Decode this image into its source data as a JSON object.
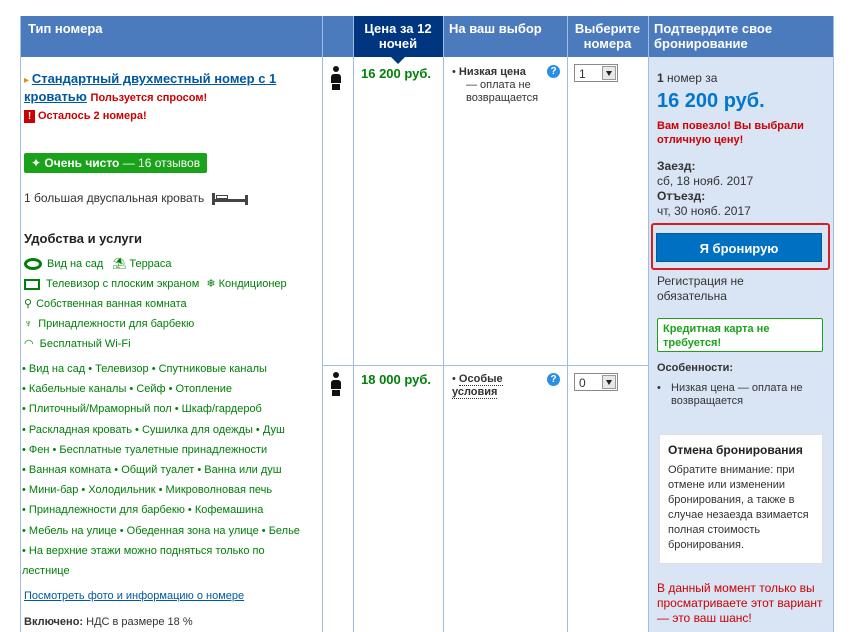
{
  "header": {
    "room_type": "Тип номера",
    "price_for_12": "Цена за 12 ночей",
    "your_choice": "На ваш выбор",
    "select_rooms": "Выберите номера",
    "confirm": "Подтвердите свое бронирование"
  },
  "room": {
    "name": "Стандартный двухместный номер с 1 кроватью",
    "demand": "Пользуется спросом!",
    "left": "Осталось 2 номера!",
    "clean_badge": "Очень чисто",
    "clean_reviews": " — 16 отзывов",
    "bed": "1 большая двуспальная кровать",
    "amenities_title": "Удобства и услуги",
    "view_link": "Посмотреть фото и информацию о номере",
    "included_label": "Включено:",
    "included_value": " НДС в размере 18 %"
  },
  "amenities_icons": {
    "garden": "Вид на сад",
    "terrace": "Терраса",
    "tv": "Телевизор с плоским экраном",
    "ac": "Кондиционер",
    "bath": "Собственная ванная комната",
    "bbq": "Принадлежности для барбекю",
    "wifi": "Бесплатный Wi-Fi"
  },
  "facility_lines": [
    "• Вид на сад  • Телевизор  • Спутниковые каналы",
    "• Кабельные каналы  • Сейф  • Отопление",
    "• Плиточный/Мраморный пол  • Шкаф/гардероб",
    "• Раскладная кровать  • Сушилка для одежды  • Душ",
    "• Фен  • Бесплатные туалетные принадлежности",
    "• Ванная комната  • Общий туалет  • Ванна или душ",
    "• Мини-бар  • Холодильник  • Микроволновая печь",
    "• Принадлежности для барбекю  • Кофемашина",
    "• Мебель на улице  • Обеденная зона на улице  • Белье",
    "• На верхние этажи можно подняться только по",
    "лестнице"
  ],
  "offers": [
    {
      "price": "16 200 руб.",
      "cond_title": "Низкая цена",
      "cond_text": "— оплата не возвращается",
      "qty": "1"
    },
    {
      "price": "18 000 руб.",
      "cond_title": "Особые условия",
      "qty": "0"
    }
  ],
  "confirm": {
    "rooms_count": "1",
    "rooms_label": " номер за",
    "total": "16 200 руб.",
    "lucky": "Вам повезло! Вы выбрали отличную цену!",
    "checkin_label": "Заезд:",
    "checkin_date": "сб, 18 нояб. 2017",
    "checkout_label": "Отъезд:",
    "checkout_date": "чт, 30 нояб. 2017",
    "book_button": "Я бронирую",
    "registration": "Регистрация не обязательна",
    "no_card": "Кредитная карта не требуется!",
    "features_title": "Особенности:",
    "feature_1": "Низкая цена — оплата не возвращается",
    "cancel_title": "Отмена бронирования",
    "cancel_text": "Обратите внимание: при отмене или изменении бронирования, а также в случае незаезда взимается полная стоимость бронирования.",
    "viewing_now": "В данный момент только вы просматриваете этот вариант — это ваш шанс!"
  },
  "colors": {
    "header": "#4b7bbd",
    "header_dark": "#003580",
    "button": "#0071c2",
    "green": "#008009",
    "red": "#cc0000",
    "confirm_bg": "#d9e5f4"
  }
}
